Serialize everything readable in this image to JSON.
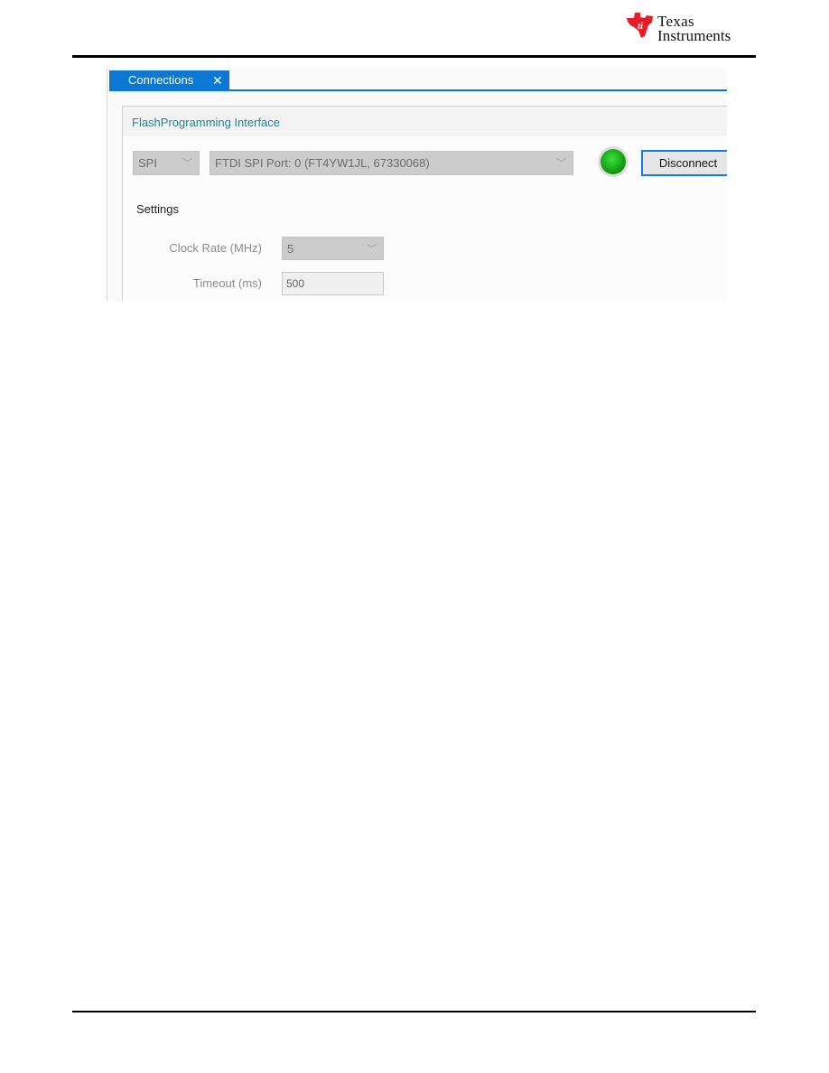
{
  "header": {
    "logo_text": [
      "Texas",
      "Instruments"
    ]
  },
  "window": {
    "tab": {
      "label": "Connections",
      "close": "✕"
    },
    "group_title": "FlashProgramming Interface",
    "interface_select": {
      "value": "SPI"
    },
    "port_select": {
      "value": "FTDI SPI Port: 0 (FT4YW1JL, 67330068)"
    },
    "status_led": {
      "state": "connected",
      "color": "#16b516"
    },
    "disconnect_label": "Disconnect",
    "settings_title": "Settings",
    "clock_rate": {
      "label": "Clock Rate (MHz)",
      "value": "5"
    },
    "timeout": {
      "label": "Timeout (ms)",
      "value": "500"
    }
  },
  "colors": {
    "accent": "#0a78d4",
    "ti_red": "#e41e26",
    "group_title": "#1d8593"
  }
}
